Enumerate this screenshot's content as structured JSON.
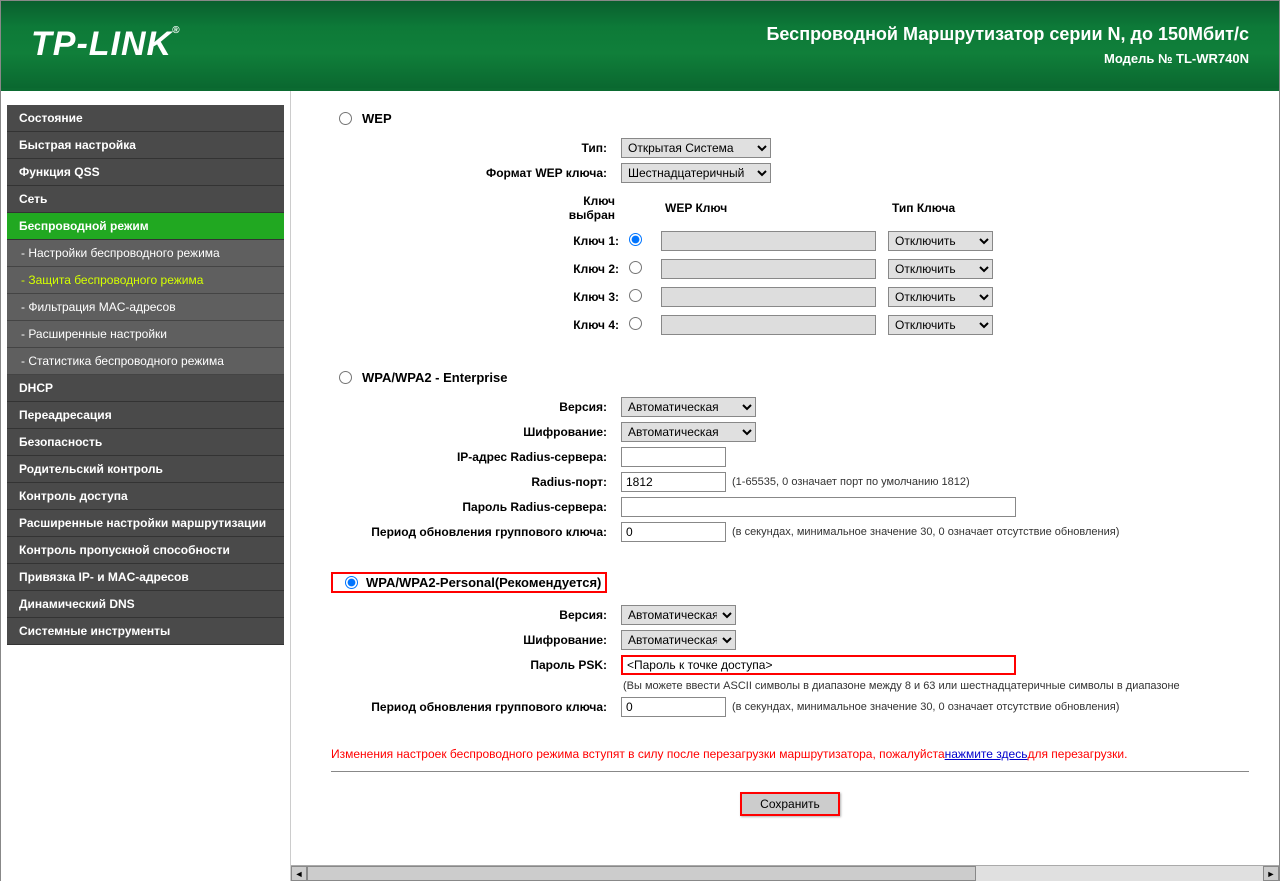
{
  "header": {
    "logo": "TP-LINK",
    "title": "Беспроводной Маршрутизатор серии N, до 150Мбит/с",
    "model": "Модель № TL-WR740N"
  },
  "sidebar": {
    "items": [
      {
        "label": "Состояние",
        "type": "menu"
      },
      {
        "label": "Быстрая настройка",
        "type": "menu"
      },
      {
        "label": "Функция QSS",
        "type": "menu"
      },
      {
        "label": "Сеть",
        "type": "menu"
      },
      {
        "label": "Беспроводной режим",
        "type": "menu",
        "active": true
      },
      {
        "label": "- Настройки беспроводного режима",
        "type": "sub"
      },
      {
        "label": "- Защита беспроводного режима",
        "type": "sub",
        "active": true
      },
      {
        "label": "- Фильтрация MAC-адресов",
        "type": "sub"
      },
      {
        "label": "- Расширенные настройки",
        "type": "sub"
      },
      {
        "label": "- Статистика беспроводного режима",
        "type": "sub"
      },
      {
        "label": "DHCP",
        "type": "menu"
      },
      {
        "label": "Переадресация",
        "type": "menu"
      },
      {
        "label": "Безопасность",
        "type": "menu"
      },
      {
        "label": "Родительский контроль",
        "type": "menu"
      },
      {
        "label": "Контроль доступа",
        "type": "menu"
      },
      {
        "label": "Расширенные настройки маршрутизации",
        "type": "menu"
      },
      {
        "label": "Контроль пропускной способности",
        "type": "menu"
      },
      {
        "label": "Привязка IP- и MAC-адресов",
        "type": "menu"
      },
      {
        "label": "Динамический DNS",
        "type": "menu"
      },
      {
        "label": "Системные инструменты",
        "type": "menu"
      }
    ]
  },
  "wep": {
    "title": "WEP",
    "type_label": "Тип:",
    "type_value": "Открытая Система",
    "format_label": "Формат WEP ключа:",
    "format_value": "Шестнадцатеричный",
    "selected_label": "Ключ выбран",
    "col_key": "WEP Ключ",
    "col_type": "Тип Ключа",
    "keys": [
      {
        "label": "Ключ 1:",
        "value": "",
        "type": "Отключить"
      },
      {
        "label": "Ключ 2:",
        "value": "",
        "type": "Отключить"
      },
      {
        "label": "Ключ 3:",
        "value": "",
        "type": "Отключить"
      },
      {
        "label": "Ключ 4:",
        "value": "",
        "type": "Отключить"
      }
    ]
  },
  "enterprise": {
    "title": "WPA/WPA2 - Enterprise",
    "version_label": "Версия:",
    "version_value": "Автоматическая",
    "cipher_label": "Шифрование:",
    "cipher_value": "Автоматическая",
    "radius_ip_label": "IP-адрес Radius-сервера:",
    "radius_ip_value": "",
    "radius_port_label": "Radius-порт:",
    "radius_port_value": "1812",
    "radius_port_help": "(1-65535, 0 означает порт по умолчанию 1812)",
    "radius_pass_label": "Пароль Radius-сервера:",
    "radius_pass_value": "",
    "rekey_label": "Период обновления группового ключа:",
    "rekey_value": "0",
    "rekey_help": "(в секундах, минимальное значение 30, 0 означает отсутствие обновления)"
  },
  "personal": {
    "title": "WPA/WPA2-Personal(Рекомендуется)",
    "version_label": "Версия:",
    "version_value": "Автоматическая",
    "cipher_label": "Шифрование:",
    "cipher_value": "Автоматическая",
    "psk_label": "Пароль PSK:",
    "psk_value": "<Пароль к точке доступа>",
    "psk_help": "(Вы можете ввести ASCII символы в диапазоне между 8 и 63 или шестнадцатеричные символы в диапазоне",
    "rekey_label": "Период обновления группового ключа:",
    "rekey_value": "0",
    "rekey_help": "(в секундах, минимальное значение 30, 0 означает отсутствие обновления)"
  },
  "notice": {
    "text_before": "Изменения настроек беспроводного режима вступят в силу после перезагрузки маршрутизатора, пожалуйста",
    "link": "нажмите здесь",
    "text_after": "для перезагрузки."
  },
  "save": "Сохранить"
}
